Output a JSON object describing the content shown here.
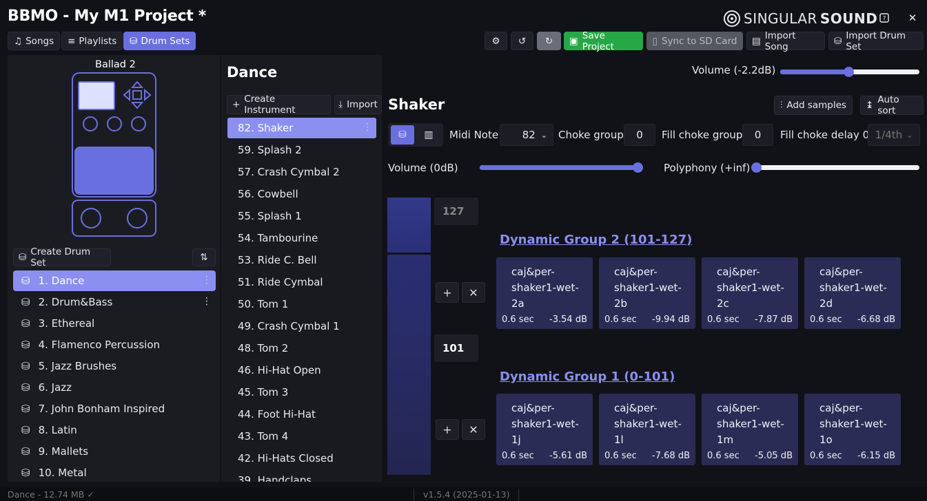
{
  "app": {
    "title": "BBMO - My M1 Project *",
    "brand_light": "SINGULAR",
    "brand_bold": "SOUND"
  },
  "nav": {
    "songs": "Songs",
    "playlists": "Playlists",
    "drumsets": "Drum Sets"
  },
  "toolbar": {
    "save": "Save Project",
    "sync": "Sync to SD Card",
    "import_song": "Import Song",
    "import_drumset": "Import Drum Set"
  },
  "left": {
    "pedal_name": "Ballad 2",
    "create": "Create Drum Set",
    "drumsets": [
      "1. Dance",
      "2. Drum&Bass",
      "3. Ethereal",
      "4. Flamenco Percussion",
      "5. Jazz Brushes",
      "6. Jazz",
      "7. John Bonham Inspired",
      "8. Latin",
      "9. Mallets",
      "10. Metal"
    ]
  },
  "middle": {
    "kit_title": "Dance",
    "create": "Create Instrument",
    "import": "Import",
    "instruments": [
      "82. Shaker",
      "59. Splash 2",
      "57. Crash Cymbal 2",
      "56. Cowbell",
      "55. Splash 1",
      "54. Tambourine",
      "53. Ride C. Bell",
      "51. Ride Cymbal",
      "50. Tom 1",
      "49. Crash Cymbal 1",
      "48. Tom 2",
      "46. Hi-Hat Open",
      "45. Tom 3",
      "44. Foot Hi-Hat",
      "43. Tom 4",
      "42. Hi-Hats Closed",
      "39. Handclaps"
    ]
  },
  "kit_volume": {
    "label": "Volume (-2.2dB)",
    "level": 0.49
  },
  "instrument": {
    "title": "Shaker",
    "add_samples": "Add samples",
    "auto_sort": "Auto sort",
    "midi_label": "Midi Note",
    "midi_value": "82",
    "choke_label": "Choke group",
    "choke_value": "0",
    "fill_choke_label": "Fill choke group",
    "fill_choke_value": "0",
    "fill_delay_label": "Fill choke delay 0",
    "fill_delay_value": "1/4th",
    "volume_label": "Volume (0dB)",
    "volume_level": 1.0,
    "polyphony_label": "Polyphony (+inf)",
    "polyphony_level": 0.0
  },
  "velocity": {
    "top": "127",
    "mid": "101"
  },
  "groups": [
    {
      "title": "Dynamic Group 2 (101-127)",
      "samples": [
        {
          "name": "caj&per-shaker1-wet-2a",
          "dur": "0.6 sec",
          "db": "-3.54 dB"
        },
        {
          "name": "caj&per-shaker1-wet-2b",
          "dur": "0.6 sec",
          "db": "-9.94 dB"
        },
        {
          "name": "caj&per-shaker1-wet-2c",
          "dur": "0.6 sec",
          "db": "-7.87 dB"
        },
        {
          "name": "caj&per-shaker1-wet-2d",
          "dur": "0.6 sec",
          "db": "-6.68 dB"
        }
      ]
    },
    {
      "title": "Dynamic Group 1 (0-101)",
      "samples": [
        {
          "name": "caj&per-shaker1-wet-1j",
          "dur": "0.6 sec",
          "db": "-5.61 dB"
        },
        {
          "name": "caj&per-shaker1-wet-1l",
          "dur": "0.6 sec",
          "db": "-7.68 dB"
        },
        {
          "name": "caj&per-shaker1-wet-1m",
          "dur": "0.6 sec",
          "db": "-5.05 dB"
        },
        {
          "name": "caj&per-shaker1-wet-1o",
          "dur": "0.6 sec",
          "db": "-6.15 dB"
        }
      ]
    }
  ],
  "status": {
    "left": "Dance - 12.74 MB ✓",
    "version": "v1.5.4 (2025-01-13)"
  },
  "colors": {
    "accent": "#6a6fe0",
    "accent_light": "#8a8ff0",
    "save": "#27a745",
    "sample_bg": "#2a2c56"
  }
}
